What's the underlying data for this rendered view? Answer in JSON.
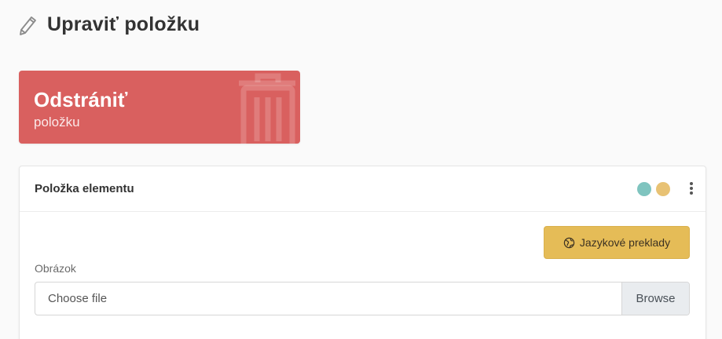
{
  "page": {
    "title": "Upraviť položku"
  },
  "delete_tile": {
    "title": "Odstrániť",
    "subtitle": "položku",
    "color": "#d9605f"
  },
  "card": {
    "title": "Položka elementu",
    "status_dots": [
      "#7fc4bf",
      "#e8c274"
    ],
    "translations_button": "Jazykové preklady",
    "image_field": {
      "label": "Obrázok",
      "placeholder": "Choose file",
      "browse_label": "Browse"
    }
  },
  "colors": {
    "accent_yellow": "#e5bc57",
    "danger": "#d9605f"
  },
  "icons": [
    "pencil-icon",
    "trash-icon",
    "globe-icon",
    "more-vertical-icon"
  ]
}
